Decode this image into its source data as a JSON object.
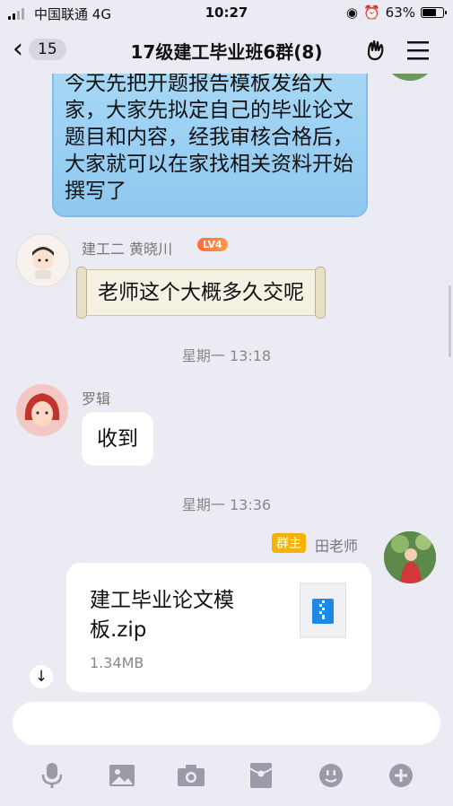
{
  "status_bar": {
    "carrier": "中国联通",
    "network": "4G",
    "time": "10:27",
    "battery": "63%"
  },
  "nav": {
    "back_count": "15",
    "title": "17级建工毕业班6群(8)"
  },
  "messages": {
    "teacher_text": "今天先把开题报告模板发给大家，大家先拟定自己的毕业论文题目和内容，经我审核合格后，大家就可以在家找相关资料开始撰写了",
    "msg1": {
      "sender": "建工二 黄晓川",
      "level": "LV4",
      "text": "老师这个大概多久交呢"
    },
    "ts1": "星期一 13:18",
    "msg2": {
      "sender": "罗辑",
      "text": "收到"
    },
    "ts2": "星期一 13:36",
    "msg3": {
      "role_badge": "群主",
      "sender": "田老师",
      "file_name": "建工毕业论文模板.zip",
      "file_size": "1.34MB"
    }
  },
  "input": {
    "placeholder": ""
  },
  "toolbar": [
    "microphone-icon",
    "image-icon",
    "camera-icon",
    "red-packet-icon",
    "emoji-icon",
    "plus-icon"
  ],
  "colors": {
    "blue_bubble": "#a8d8f6",
    "badge": "#f5b300",
    "background": "#ebebf3"
  }
}
